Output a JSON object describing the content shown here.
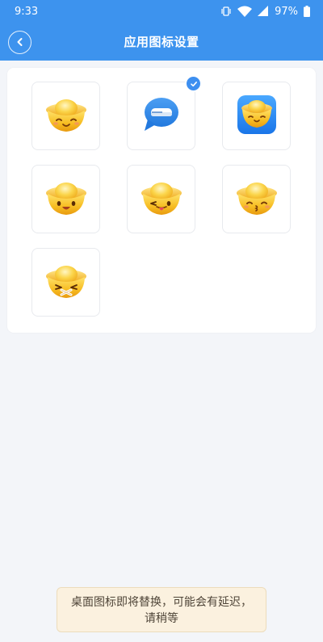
{
  "status_bar": {
    "time": "9:33",
    "battery": "97%",
    "icons": [
      "vibrate-icon",
      "wifi-icon",
      "signal-icon",
      "battery-icon"
    ]
  },
  "header": {
    "title": "应用图标设置",
    "back_icon": "chevron-left-icon"
  },
  "icons": [
    {
      "name": "ingot-smile-icon",
      "selected": false
    },
    {
      "name": "chat-bubble-icon",
      "selected": true
    },
    {
      "name": "blue-square-ingot-icon",
      "selected": false
    },
    {
      "name": "ingot-happy-icon",
      "selected": false
    },
    {
      "name": "ingot-tongue-icon",
      "selected": false
    },
    {
      "name": "ingot-kiss-icon",
      "selected": false
    },
    {
      "name": "ingot-mask-icon",
      "selected": false
    }
  ],
  "toast": {
    "message": "桌面图标即将替换，可能会有延迟，请稍等"
  },
  "colors": {
    "primary": "#3d93ee",
    "background": "#f3f5f9",
    "toast_bg": "#fbf1df",
    "gold": "#f5b31f"
  }
}
